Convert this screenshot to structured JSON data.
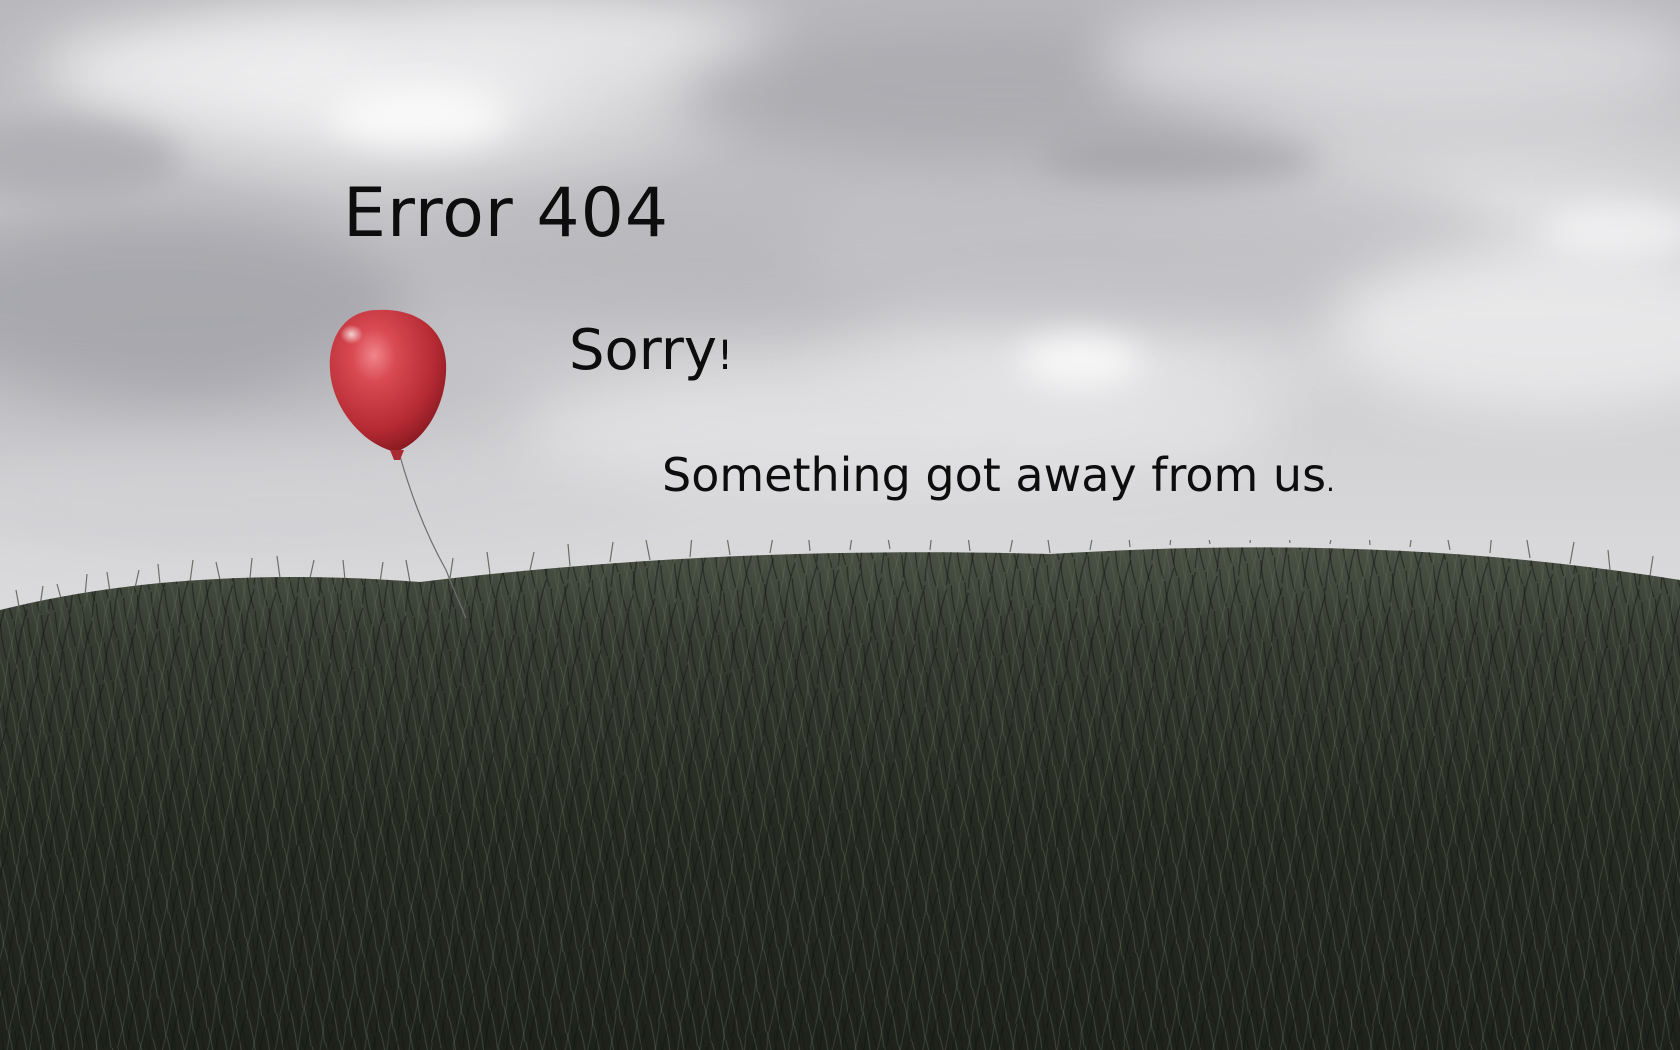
{
  "page": {
    "heading": "Error 404",
    "apology": {
      "word": "Sorry",
      "punctuation": "!"
    },
    "message": {
      "text": "Something got away from us",
      "punctuation": "."
    }
  },
  "illustration": {
    "balloon_icon": "red-balloon",
    "colors": {
      "balloon": "#c8323a",
      "grass": "#2c3127",
      "sky": "#d4d4d6",
      "text": "#0d0d0d"
    }
  }
}
